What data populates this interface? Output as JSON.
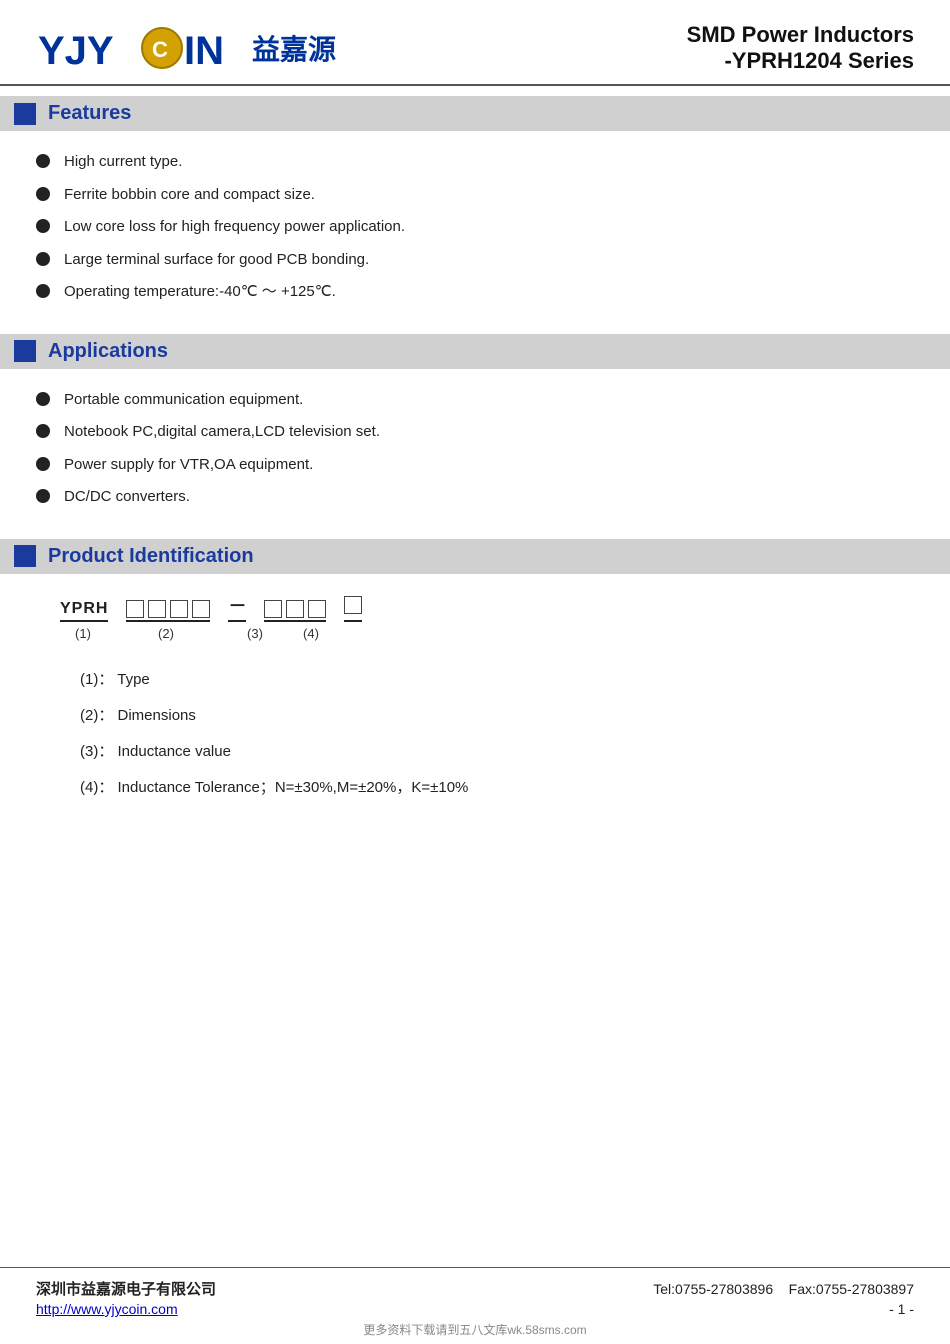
{
  "header": {
    "logo_text": "YJYCOIN",
    "logo_cn": "益嘉源",
    "title_line1": "SMD Power Inductors",
    "title_line2": "-YPRH1204 Series"
  },
  "features": {
    "section_title": "Features",
    "items": [
      "High current type.",
      "Ferrite bobbin core and compact size.",
      "Low core loss for high frequency power application.",
      "Large terminal surface for good PCB bonding.",
      "Operating temperature:-40℃ ～ +125℃."
    ]
  },
  "applications": {
    "section_title": "Applications",
    "items": [
      "Portable communication equipment.",
      "Notebook PC,digital camera,LCD television set.",
      "Power supply for VTR,OA equipment.",
      "DC/DC converters."
    ]
  },
  "product_identification": {
    "section_title": "Product Identification",
    "prefix": "YPRH",
    "num1": "(1)",
    "num2": "(2)",
    "num3": "(3)",
    "num4": "(4)",
    "details": [
      {
        "num": "(1)",
        "label": "：  Type"
      },
      {
        "num": "(2)",
        "label": "：  Dimensions"
      },
      {
        "num": "(3)",
        "label": "：  Inductance value"
      },
      {
        "num": "(4)",
        "label": "：  Inductance Tolerance；N=±30%,M=±20%，K=±10%"
      }
    ]
  },
  "footer": {
    "company": "深圳市益嘉源电子有限公司",
    "tel": "Tel:0755-27803896",
    "fax": "Fax:0755-27803897",
    "website": "http://www.yjycoin.com",
    "page": "- 1 -",
    "watermark": "更多资料下载请到五八文库wk.58sms.com"
  }
}
